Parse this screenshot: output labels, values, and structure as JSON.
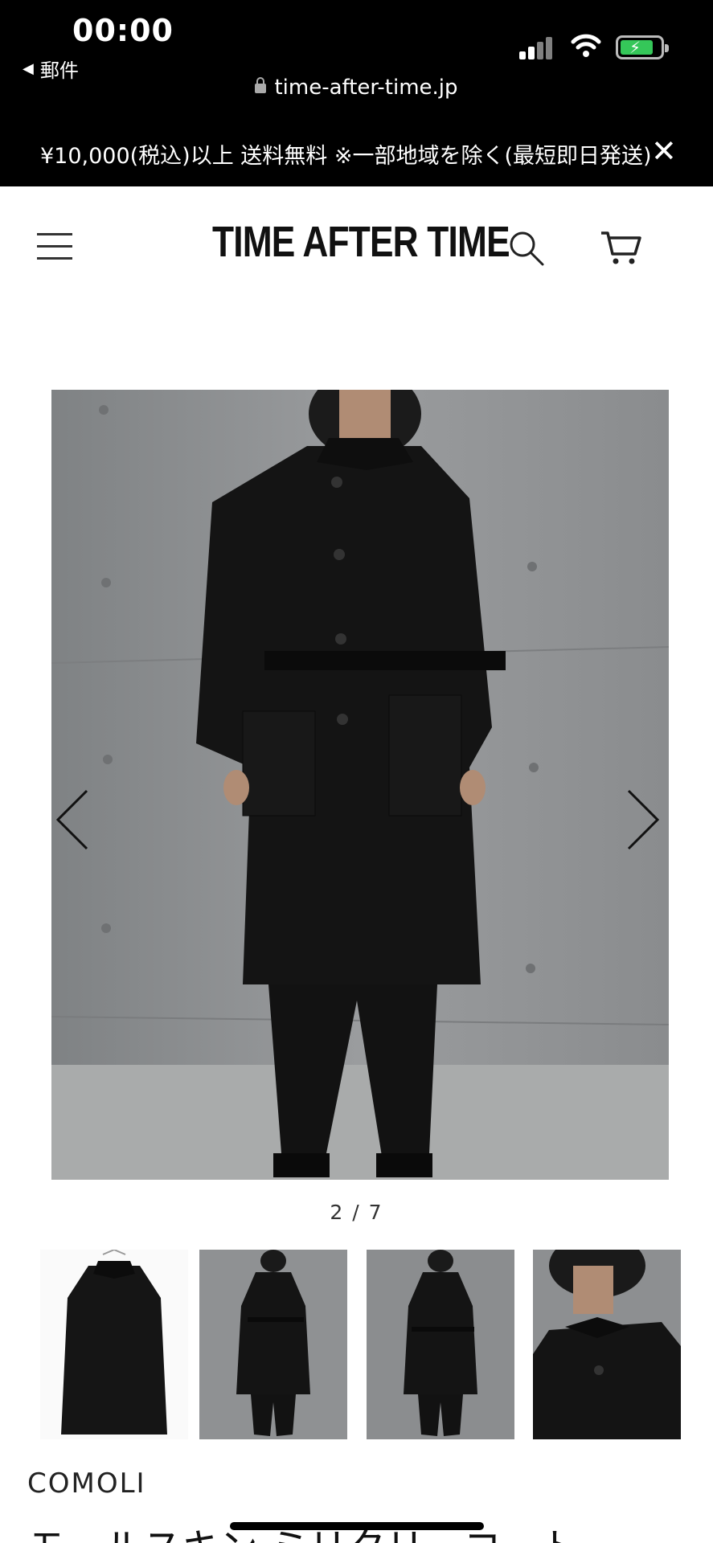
{
  "status_bar": {
    "time": "00:00",
    "back_app_label": "郵件"
  },
  "browser": {
    "url": "time-after-time.jp"
  },
  "promo_banner": {
    "text": "¥10,000(税込)以上 送料無料 ※一部地域を除く(最短即日発送)",
    "close_icon": "close-icon"
  },
  "header": {
    "logo": "TIME AFTER TIME",
    "menu_icon": "hamburger-menu-icon",
    "search_icon": "search-icon",
    "cart_icon": "cart-icon"
  },
  "gallery": {
    "counter": "2 / 7",
    "current_index": 2,
    "total": 7,
    "prev_icon": "chevron-left-icon",
    "next_icon": "chevron-right-icon",
    "main_image_alt": "Model wearing black belted coat against concrete wall",
    "thumbnails": [
      "Black coat on hanger, white background",
      "Model front view, belted coat",
      "Model back view, belted coat",
      "Collar close-up on model"
    ]
  },
  "product": {
    "brand": "COMOLI",
    "title": "モールスキン ミリタリーコート"
  },
  "colors": {
    "topbar_bg": "#000000",
    "battery_green": "#35c759",
    "wall_gray": "#8e9092"
  }
}
